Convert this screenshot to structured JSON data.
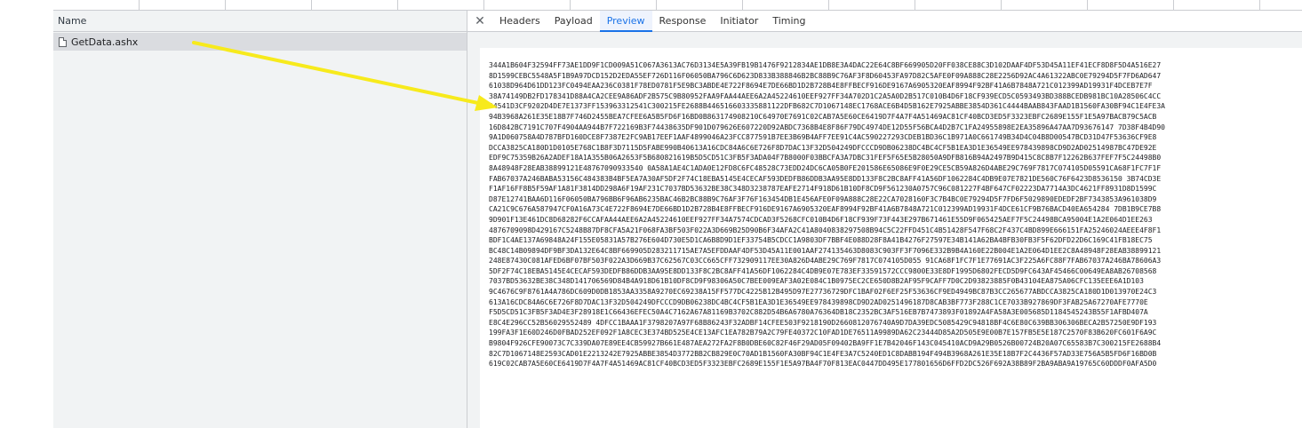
{
  "request_list": {
    "column_header": "Name",
    "requests": [
      {
        "name": "GetData.ashx"
      }
    ]
  },
  "details": {
    "close_label": "✕",
    "tabs": [
      {
        "label": "Headers"
      },
      {
        "label": "Payload"
      },
      {
        "label": "Preview"
      },
      {
        "label": "Response"
      },
      {
        "label": "Initiator"
      },
      {
        "label": "Timing"
      }
    ],
    "active_tab": "Preview"
  },
  "preview": {
    "lines": [
      "344A1B604F32594FF73AE1DD9F1CD009A51C067A3613AC76D3134E5A39FB19B1476F9212834AE1DB8E3A4DAC22E64C8BF669905D20FF038CE88C3D102DAAF4DF53D45A11EF41ECF8D8F5D4A516E27",
      "8D1599CEBC5548A5F1B9A97DCD152D2EDA55EF726D116F06050BA796C6D623D833B388846B2BC88B9C76AF3F8D60453FA97D82C5AFE0F09A888C28E2256D92AC4A61322ABC0E79294D5F7FD6AD647",
      "61038D964D61DD123FC0494EAA236C0381F78ED0781F5E9BC3ABDE4E722F8694E7DE66BD1D2B728B4E8FFBECF916DE9167A6905320EAF8994F92BF41A6B7848A721C012399AD19931F4DCEB7E7F",
      "38A74149DB2FD178341D88A4CA2CEE9A86ADF2B575C9B80952FAA9FAA44AEE6A2A45224610EEF927FF34A702D1C2A5A0D2B517C010B4D6F18CF939ECD5C0593493BD388BCEDB981BC10A28506C4CC",
      "04541D3CF9202D4DE7E1373FF153963312541C300215FE2688B446516603335881122DFB682C7D1067148EC1768ACE6B4D5B162E7925ABBE3854D361C4444BAAB843FAAD1B1560FA30BF94C1E4FE3A",
      "94B3968A261E35E18B7F746D2455BEA7CFEE6A5B5FD6F16BD0B863174908210C64970E7691C02CAB7A5E60CE6419D7F4A7F4A51469AC81CF40BCD3ED5F3323EBFC2689E155F1E5A97BACB79C5ACB",
      "16D842BC7191C707F4904AA944B7F722169B3F74438635DF901D079626E607220D92ABDC7368B4E8F86F79DC4974DE12D55F56BCA4D2B7C1FA24955898E2EA35896A47AA7D93676147 7D38F4B4D90",
      "9A1D060758A4D787BFD160DCE8F7387E2FC9AB17EEF1AAF4899046A23FCC877591B7EE3B69B4AFF7EE91C4AC590227293CDEB1BD36C1B971A0C661749B34D4C04B8D00547BCD31D47F53636CF9E8",
      "DCCA3825CA180D1D0105E768C1B8F3D7115D5FABE990B40613A16CDC84A6C6E726F8D7DAC13F32D504249DFCCCD9DB06238DC4BC4CF5B1EA3D1E36549EE978439898CD9D2AD02514987BC47DE92E",
      "EDF9C75359B26A2ADEF18A1A355B06A2653F5B680821619B5D5CD51C3FB5F3ADA04F7B8000F03BBCFA3A7DBC31FEF5F65E5B28050A9DFB816B94A2497B9D415C8C8B7F12262B637FEF7F5C24498B0",
      "8A48948F28EAB38899121E48767090933540 0A58A1AE4C1ADA0E12FD8C6FC48528C73EDD24DC6CA05B0FE201586E65086E9F0E29CE5CB59A826D4ABE29C769F7817C074105D05591CA68F1FC7F1F",
      "FAB67037A246BABA53156C484383B4BF5EA7A30AF5DF2F74C18EBA5145E4CECAF593DEDFB86DDB3AA95E8DD133F8C2BC8AFF41A56DF1062284C4DB9E07E7821DE560C76F6423D8536150 3B74CD3E",
      "F1AF16FF8B5F59AF1A81F3814DD298A6F19AF231C7037BD53632BE38C348D3238787EAFE2714F918D61B10DF8CD9F561230A0757C96C081227F4BF647CF02223DA7714A3DC4621FF8931D8D1599C",
      "D87E12741BAA6D116F06050BA796BB6F96AB6235BAC46B2BC88B9C76AF3F76F163454DB1E456AFE0F09A888C28E22CA7028160F3C7B4BC0E79294D5F7FD6F5029890EDEDF2BF7343853A961038D9",
      "CA21C9C676A587947CF0A16A73C4E722F8694E7DE66BD1D2B728B4E8FFBECF916DE9167A6905320EAF8994F92BF41A6B7848A721C012399AD19931F4DCE61CF9B76BACD40EA654284 7DB1B9CE7B8",
      "9D901F13E461DC8D68282F6CCAFAA44AEE6A2A45224610EEF927FF34A7574CDCAD3F5268CFC010B4D6F18CF939F73F443E297B671461E55D9F065425AEF7F5C24498BCA95004E1A2E064D1EE263",
      "4876709098D429167C5248B87DF8CFA5A21F068FA3BF503F022A3D669B25D90B6F34AFA2C41A8040838297508B94C5C22FFD451C4B51428F547F68C2F437C4BD899E666151FA25246024AEEE4F8F1",
      "BDF1C4AE137A69848A24F155E05831A57B276E604D730E5D1CA6B8D9D1EF33754B5CDCC1A9803DF7BBF4E088D28F8A41B4276F27597E34B141A62BA4BFB30FB3F5F62DFD22D6C169C41FB18EC75",
      "BC48C14B09894DF9BF3DA132E64C8BF669905D283211715AE7A5EFDDAAF4DF53D45A11E001AAF274135463D8083C903FF3F7096E332B9B4A160E22B004E1A2E064D1EE2C8A48948F28EAB38899121",
      "248E87430C081AFED6BF07BF503F022A3D669B37C62567C03CC665CFF732909117EE30A826D4ABE29C769F7817C074105D055 91CA68F1FC7F1E77691AC3F225A6FC88F7FAB67037A246BA78606A3",
      "5DF2F74C18EBA5145E4CECAF593DEDFB86DDB3AA95E8DD133F8C2BC8AFF41A56DF1062284C4DB9E07E783EF33591572CCC9800E33E8DF1995D6802FECD5D9FC643AF45466C00649EA8AB26708568",
      "7037BD53632BE38C348D141706569D84B4A918D61B10DF8CD9F98306A50C7BEE009EAF3A02E084C1B0975EC2CE650D8B2AF95F9CAFF7D0C2D93823885F0B43104EA875A06CFC135EEE6A1D103",
      "9C4676C9F8761A4A786DC609D0DB1853AA3358A9270EC69238A15FF577DC4225B12B495D97E27736729DFC1BAF02F6EF25F53636CF9ED4949BC87B3CC265677ABDCCA3825CA180D1D013970E24C3",
      "613A16CDC84A6C6E726F8D7DAC13F32D504249DFCCCD9DB06238DC4BC4CF5B1EA3D1E36549EE978439898CD9D2AD0251496187D8CAB3BF773F288C1CE7033B927869DF3FAB25A67270AFE7770E",
      "F5D5CD51C3FB5F3AD4E3F28918E1C66436EFEC50A4C7162A67A81169B3702C882D54B6A6780A76364DB18C2352BC3AF516EB7B7473893F01892A4FA58A3E005685D1184545243B55F1AFBD407A",
      "E8C4E296CC52B56029552489 4DFCC1BAAA1F3798207A97F68B86243F32ADBF14CFEE503F9218190D2660812076740A9D7DA39EDC5085429C94818BF4C6E80C639BB306306BECA2B57250E9DF193",
      "199FA3F1E60D246D0FBAD252EF092F1A8CEC3E374BD525E4CE13AFC1EA782B79A2C79FE40372C10FAD1DE76511A9989DA62C23444D85A2D505E9E00B7E157FB5E5E187C2570F83B620FC601F6A9C",
      "B9804F926CFE90073C7C339DA07E89EE4CB59927B661E487AEA272FA2F8B0DBE60C82F46F29AD05F09402BA9FF1E7B42046F143C045410ACD9A29B0526B00724B20A07C65583B7C300215FE2688B4",
      "82C7D1067148E2593CAD01E2213242E7925ABBE3854D3772BB2CB829E0C70AD1B1560FA30BF94C1E4FE3A7C5240ED1C8DABB194F494B3968A261E35E18B7F2C4436F57AD33E756A5B5FD6F16BD0B",
      "619C02CAB7A5E60CE6419D7F4A7F4A51469AC81CF40BCD3ED5F3323EBFC2689E155F1E5A97BA4F70F813EAC0447DD495E177801656D6FFD2DC526F692A38B89F2BA9ABA9A19765C60DDDF0AFA5D0"
    ]
  }
}
